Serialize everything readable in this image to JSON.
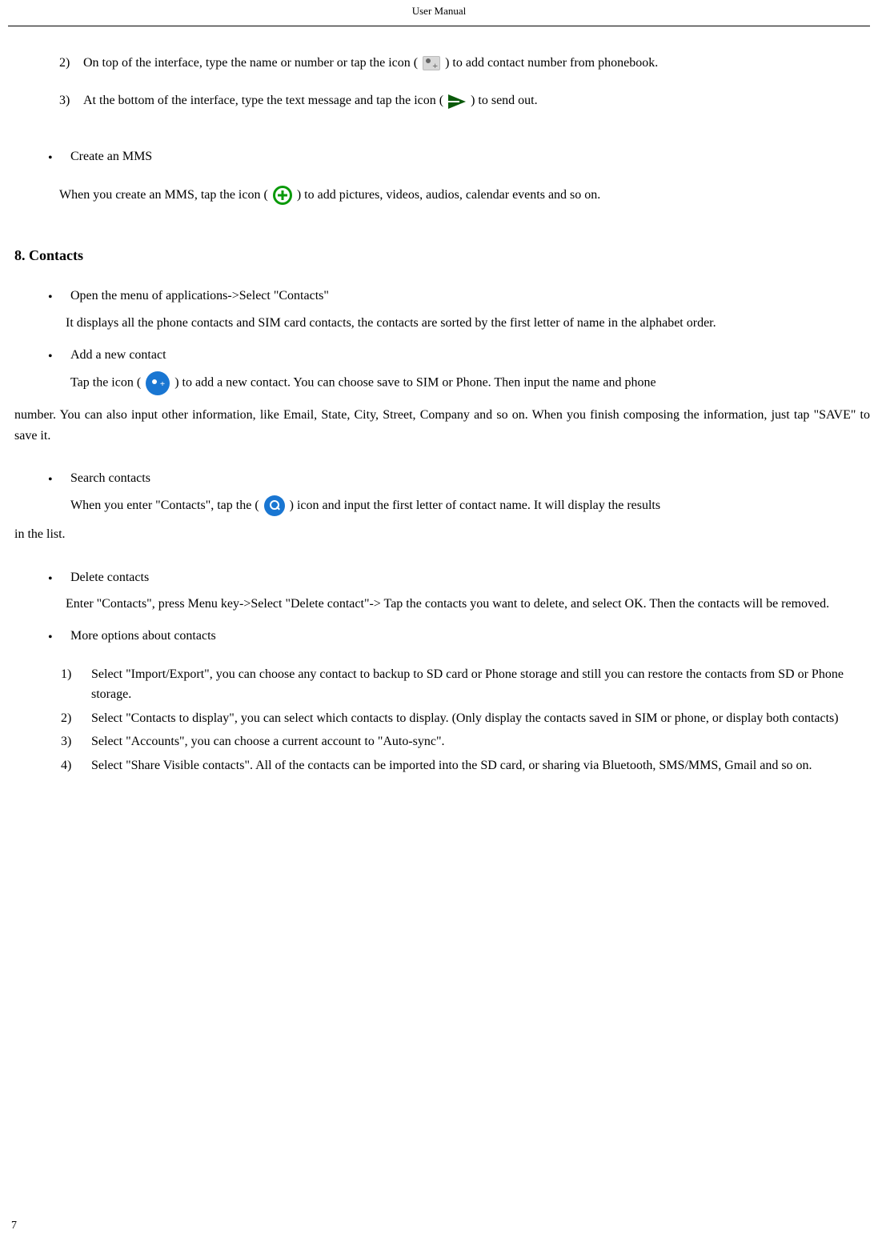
{
  "header": "User Manual",
  "sms": {
    "step2_a": "2)",
    "step2_b": "On top of the interface, type the name or number or tap the icon (",
    "step2_c": ") to add contact number from phonebook.",
    "step3_a": "3)",
    "step3_b": "At the bottom of the interface, type the text message and tap the icon (",
    "step3_c": ") to send out."
  },
  "mms": {
    "bullet": "Create an MMS",
    "line_a": "When you create an MMS, tap the icon (",
    "line_b": ") to add pictures, videos, audios, calendar events and so on."
  },
  "contacts": {
    "title": "8. Contacts",
    "open_bullet": "Open the menu of applications->Select \"Contacts\"",
    "open_desc": "It displays all the phone contacts and SIM card contacts, the contacts are sorted by the first letter of name in the alphabet order.",
    "add_bullet": "Add a new contact",
    "add_a": "Tap the icon (",
    "add_b": ") to add a new contact. You can choose save to SIM or Phone. Then input the name and phone",
    "add_cont": "number. You can also input other information, like Email, State, City, Street, Company and so on. When you finish composing the information,   just tap \"SAVE\" to save it.",
    "search_bullet": " Search contacts",
    "search_a": "When you enter \"Contacts\", tap the (",
    "search_b": ") icon and input the first letter of contact name. It will display the results",
    "search_cont": "in the list.",
    "delete_bullet": "Delete contacts",
    "delete_desc": "Enter \"Contacts\", press Menu key->Select \"Delete contact\"-> Tap the contacts you want to delete, and select OK. Then the contacts will be removed.",
    "more_bullet": "More options about contacts",
    "opt1_m": "1)",
    "opt1": "Select \"Import/Export\", you can choose any contact to backup to SD card or Phone storage and still you can restore the contacts from SD or Phone storage.",
    "opt2_m": "2)",
    "opt2": "Select \"Contacts to display\", you can select which contacts to display. (Only display the contacts saved in SIM or phone, or display both contacts)",
    "opt3_m": "3)",
    "opt3": "Select \"Accounts\", you can choose a current account to \"Auto-sync\".",
    "opt4_m": "4)",
    "opt4": "Select \"Share Visible contacts\". All of the contacts can be imported into the SD card, or sharing via Bluetooth, SMS/MMS, Gmail and so on."
  },
  "page_number": "7"
}
